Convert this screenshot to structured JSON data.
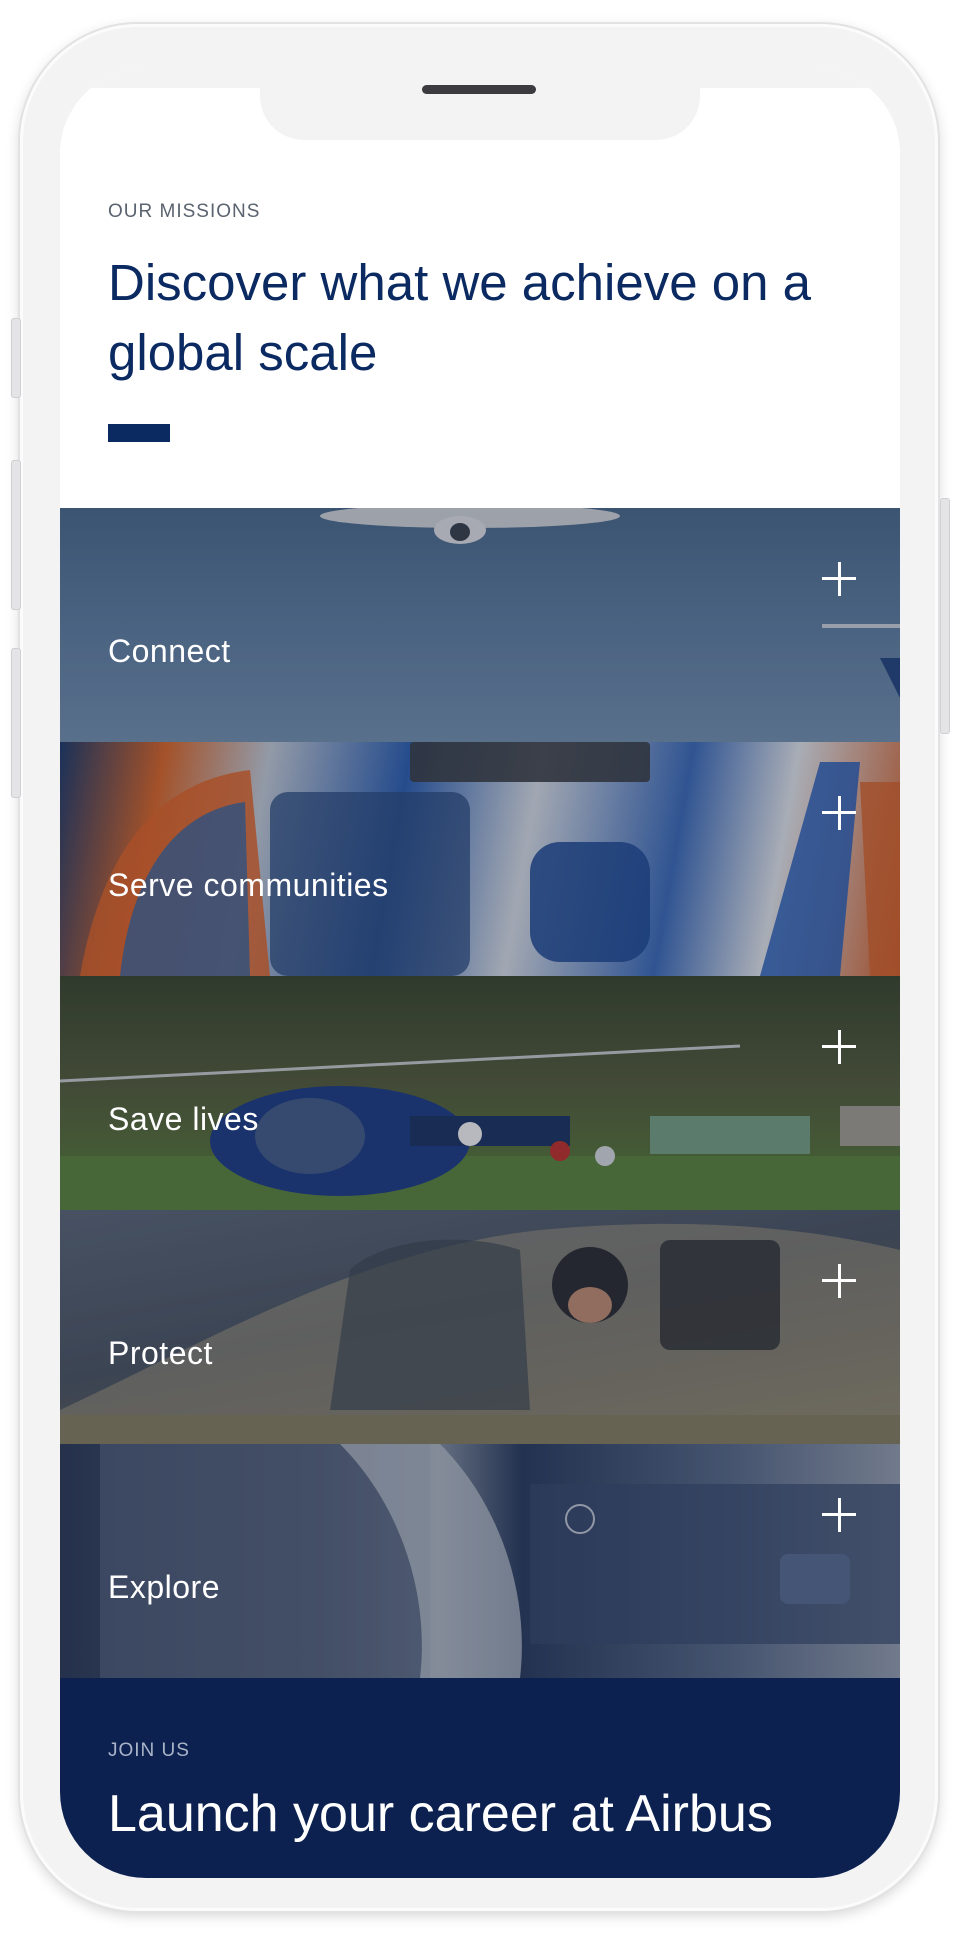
{
  "intro": {
    "eyebrow": "OUR MISSIONS",
    "headline": "Discover what we achieve on a global scale"
  },
  "missions": [
    {
      "label": "Connect",
      "icon": "plus-icon"
    },
    {
      "label": "Serve communities",
      "icon": "plus-icon"
    },
    {
      "label": "Save lives",
      "icon": "plus-icon"
    },
    {
      "label": "Protect",
      "icon": "plus-icon"
    },
    {
      "label": "Explore",
      "icon": "plus-icon"
    }
  ],
  "join": {
    "eyebrow": "JOIN US",
    "title": "Launch your career at Airbus"
  },
  "colors": {
    "brand_navy": "#0b2a62",
    "join_background": "#0c2150",
    "accent_bar": "#0b2a62"
  }
}
